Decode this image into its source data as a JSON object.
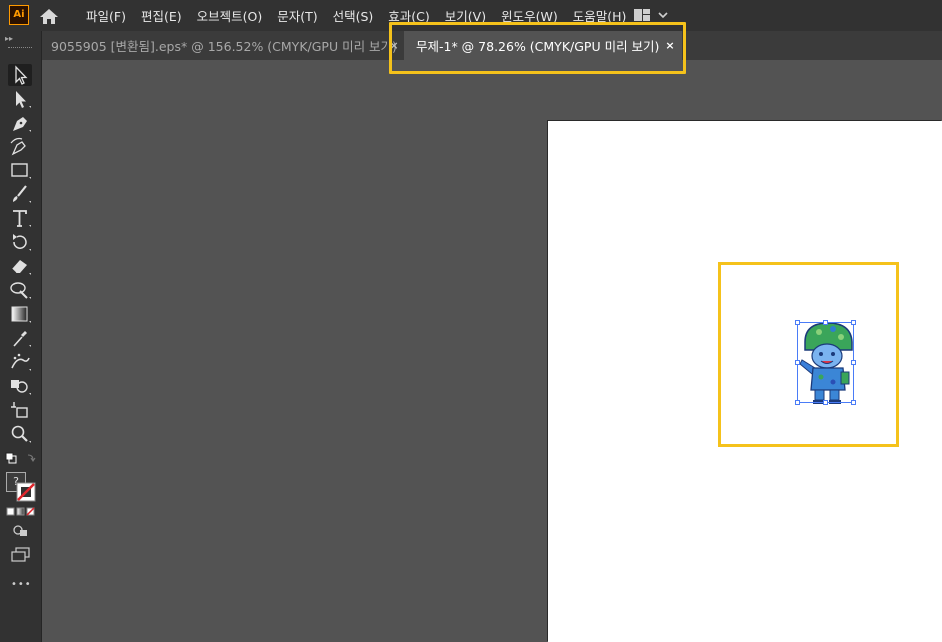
{
  "app": {
    "logo_text": "Ai"
  },
  "menu": [
    {
      "label": "파일(F)"
    },
    {
      "label": "편집(E)"
    },
    {
      "label": "오브젝트(O)"
    },
    {
      "label": "문자(T)"
    },
    {
      "label": "선택(S)"
    },
    {
      "label": "효과(C)"
    },
    {
      "label": "보기(V)"
    },
    {
      "label": "윈도우(W)"
    },
    {
      "label": "도움말(H)"
    }
  ],
  "tabs": [
    {
      "label": "9055905 [변환됨].eps* @ 156.52% (CMYK/GPU 미리 보기)",
      "close": "×",
      "active": false
    },
    {
      "label": "무제-1* @ 78.26% (CMYK/GPU 미리 보기)",
      "close": "×",
      "active": true
    }
  ],
  "toolbar": {
    "tools": [
      {
        "icon": "selection-tool-icon"
      },
      {
        "icon": "direct-selection-tool-icon"
      },
      {
        "icon": "pen-tool-icon"
      },
      {
        "icon": "curvature-tool-icon"
      },
      {
        "icon": "rectangle-tool-icon"
      },
      {
        "icon": "paintbrush-tool-icon"
      },
      {
        "icon": "type-tool-icon"
      },
      {
        "icon": "rotate-tool-icon"
      },
      {
        "icon": "eraser-tool-icon"
      },
      {
        "icon": "warp-tool-icon"
      },
      {
        "icon": "gradient-tool-icon"
      },
      {
        "icon": "eyedropper-tool-icon"
      },
      {
        "icon": "symbol-sprayer-tool-icon"
      },
      {
        "icon": "shape-builder-tool-icon"
      },
      {
        "icon": "artboard-tool-icon"
      },
      {
        "icon": "zoom-tool-icon"
      }
    ],
    "fill_stroke_unknown_label": "?",
    "more_label": "•••"
  },
  "colors": {
    "accent_highlight": "#f5c21b",
    "selection": "#4a7cf7",
    "canvas_bg": "#535353",
    "panel_bg": "#323232"
  }
}
